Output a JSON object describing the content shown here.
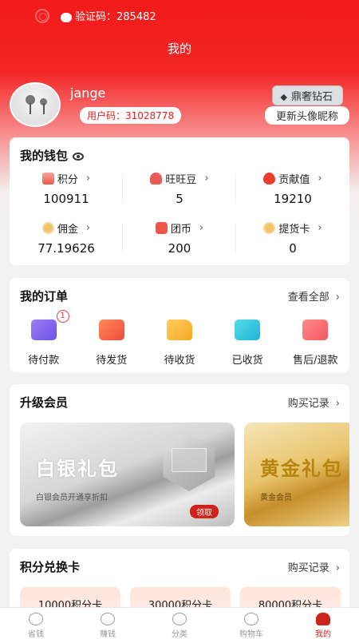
{
  "status": {
    "verify_label": "验证码：285482"
  },
  "header": {
    "title": "我的"
  },
  "profile": {
    "username": "jange",
    "user_code_label": "用户码：31028778",
    "level_badge": "鼎奢钻石",
    "edit_button": "更新头像昵称"
  },
  "wallet": {
    "title": "我的钱包",
    "items": [
      {
        "label": "积分",
        "value": "100911"
      },
      {
        "label": "旺旺豆",
        "value": "5"
      },
      {
        "label": "贡献值",
        "value": "19210"
      },
      {
        "label": "佣金",
        "value": "77.19626"
      },
      {
        "label": "团币",
        "value": "200"
      },
      {
        "label": "提货卡",
        "value": "0"
      }
    ]
  },
  "orders": {
    "title": "我的订单",
    "more": "查看全部",
    "items": [
      {
        "label": "待付款",
        "badge": "1"
      },
      {
        "label": "待发货"
      },
      {
        "label": "待收货"
      },
      {
        "label": "已收货"
      },
      {
        "label": "售后/退款"
      }
    ]
  },
  "vip": {
    "title": "升级会员",
    "more": "购买记录",
    "cards": [
      {
        "name": "白银礼包",
        "desc": "白银会员开通享折扣",
        "action": "领取"
      },
      {
        "name": "黄金礼包",
        "desc": "黄金会员"
      }
    ]
  },
  "points_card": {
    "title": "积分兑换卡",
    "more": "购买记录",
    "items": [
      {
        "label": "10000积分卡"
      },
      {
        "label": "30000积分卡"
      },
      {
        "label": "80000积分卡"
      }
    ]
  },
  "tabbar": {
    "items": [
      {
        "label": "省钱"
      },
      {
        "label": "赚钱"
      },
      {
        "label": "分类"
      },
      {
        "label": "购物车"
      },
      {
        "label": "我的"
      }
    ]
  }
}
